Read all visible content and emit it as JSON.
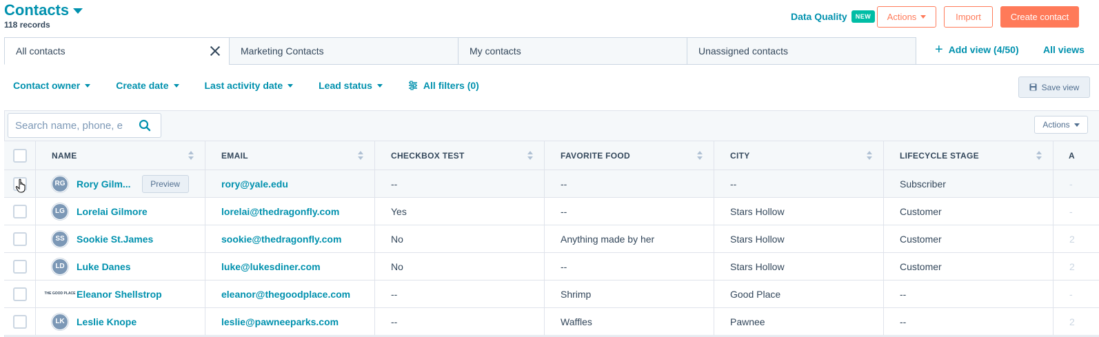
{
  "header": {
    "title": "Contacts",
    "records": "118 records",
    "data_quality": "Data Quality",
    "new_badge": "NEW",
    "actions": "Actions",
    "import": "Import",
    "create": "Create contact"
  },
  "tabs": [
    "All contacts",
    "Marketing Contacts",
    "My contacts",
    "Unassigned contacts"
  ],
  "add_view": "Add view (4/50)",
  "all_views": "All views",
  "filters": [
    "Contact owner",
    "Create date",
    "Last activity date",
    "Lead status"
  ],
  "all_filters": "All filters (0)",
  "save_view": "Save view",
  "search": {
    "placeholder": "Search name, phone, e"
  },
  "table_actions": "Actions",
  "columns": [
    "NAME",
    "EMAIL",
    "CHECKBOX TEST",
    "FAVORITE FOOD",
    "CITY",
    "LIFECYCLE STAGE",
    "A"
  ],
  "preview_label": "Preview",
  "rows": [
    {
      "initials": "RG",
      "name": "Rory Gilm...",
      "email": "rory@yale.edu",
      "checkbox": "--",
      "food": "--",
      "city": "--",
      "stage": "Subscriber",
      "extra": "-"
    },
    {
      "initials": "LG",
      "name": "Lorelai Gilmore",
      "email": "lorelai@thedragonfly.com",
      "checkbox": "Yes",
      "food": "--",
      "city": "Stars Hollow",
      "stage": "Customer",
      "extra": "-"
    },
    {
      "initials": "SS",
      "name": "Sookie St.James",
      "email": "sookie@thedragonfly.com",
      "checkbox": "No",
      "food": "Anything made by her",
      "city": "Stars Hollow",
      "stage": "Customer",
      "extra": "2"
    },
    {
      "initials": "LD",
      "name": "Luke Danes",
      "email": "luke@lukesdiner.com",
      "checkbox": "No",
      "food": "--",
      "city": "Stars Hollow",
      "stage": "Customer",
      "extra": "2"
    },
    {
      "initials": "THE GOOD PLACE",
      "name": "Eleanor Shellstrop",
      "email": "eleanor@thegoodplace.com",
      "checkbox": "--",
      "food": "Shrimp",
      "city": "Good Place",
      "stage": "--",
      "extra": "-"
    },
    {
      "initials": "LK",
      "name": "Leslie Knope",
      "email": "leslie@pawneeparks.com",
      "checkbox": "--",
      "food": "Waffles",
      "city": "Pawnee",
      "stage": "--",
      "extra": "2"
    }
  ],
  "colors": {
    "accent": "#0091ae",
    "orange": "#ff7a59",
    "teal": "#00bda5"
  }
}
